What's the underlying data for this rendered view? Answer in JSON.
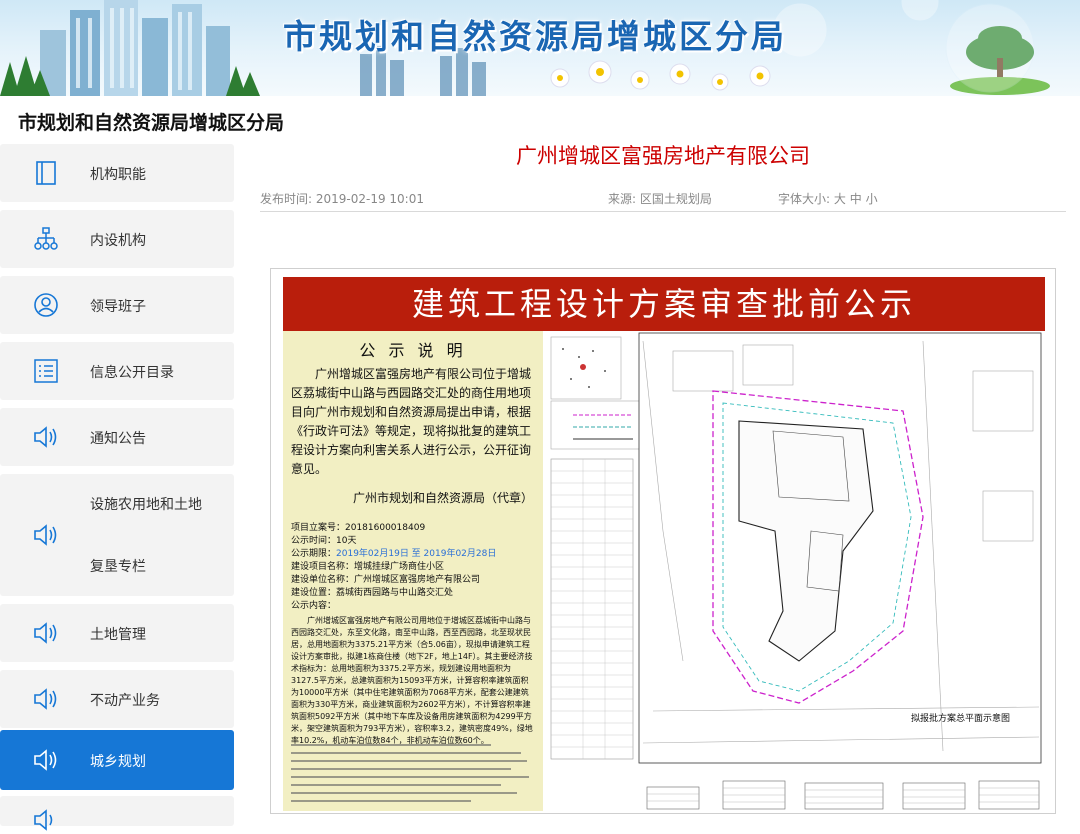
{
  "banner": {
    "title": "市规划和自然资源局增城区分局"
  },
  "site": {
    "title": "市规划和自然资源局增城区分局"
  },
  "sidebar": {
    "items": [
      {
        "label": "机构职能",
        "icon": "building-icon"
      },
      {
        "label": "内设机构",
        "icon": "org-chart-icon"
      },
      {
        "label": "领导班子",
        "icon": "user-circle-icon"
      },
      {
        "label": "信息公开目录",
        "icon": "list-icon"
      },
      {
        "label": "通知公告",
        "icon": "speaker-icon"
      },
      {
        "label_line1": "设施农用地和土地",
        "label_line2": "复垦专栏",
        "icon": "speaker-icon"
      },
      {
        "label": "土地管理",
        "icon": "speaker-icon"
      },
      {
        "label": "不动产业务",
        "icon": "speaker-icon"
      },
      {
        "label": "城乡规划",
        "icon": "speaker-icon",
        "active": true
      }
    ]
  },
  "article": {
    "title": "广州增城区富强房地产有限公司",
    "publish_time": "发布时间: 2019-02-19 10:01",
    "source": "来源: 区国土规划局",
    "font_size_label": "字体大小:",
    "font_sizes": [
      "大",
      "中",
      "小"
    ]
  },
  "notice": {
    "header": "建筑工程设计方案审查批前公示",
    "heading": "公 示 说 明",
    "body": "广州增城区富强房地产有限公司位于增城区荔城街中山路与西园路交汇处的商住用地项目向广州市规划和自然资源局提出申请，根据《行政许可法》等规定，现将拟批复的建筑工程设计方案向利害关系人进行公示，公开征询意见。",
    "signature": "广州市规划和自然资源局（代章）",
    "project_no": "项目立案号：20181600018409",
    "period": "公示时间：10天",
    "dates_label": "公示期限：",
    "dates": "2019年02月19日 至 2019年02月28日",
    "project_name": "建设项目名称：增城挂绿广场商住小区",
    "builder": "建设单位名称：广州增城区富强房地产有限公司",
    "location": "建设位置：荔城街西园路与中山路交汇处",
    "content_label": "公示内容：",
    "content": "广州增城区富强房地产有限公司用地位于增城区荔城街中山路与西园路交汇处，东至文化路，南至中山路，西至西园路，北至现状民居，总用地面积为3375.21平方米（合5.06亩），现拟申请建筑工程设计方案审批，拟建1栋商住楼（地下2F，地上14F）。其主要经济技术指标为：总用地面积为3375.2平方米，规划建设用地面积为3127.5平方米，总建筑面积为15093平方米，计算容积率建筑面积为10000平方米（其中住宅建筑面积为7068平方米，配套公建建筑面积为330平方米，商业建筑面积为2602平方米），不计算容积率建筑面积5092平方米（其中地下车库及设备用房建筑面积为4299平方米，架空建筑面积为793平方米），容积率3.2，建筑密度49%，绿地率10.2%，机动车泊位数84个，非机动车泊位数60个。",
    "plan_caption": "拟报批方案总平面示意图"
  }
}
